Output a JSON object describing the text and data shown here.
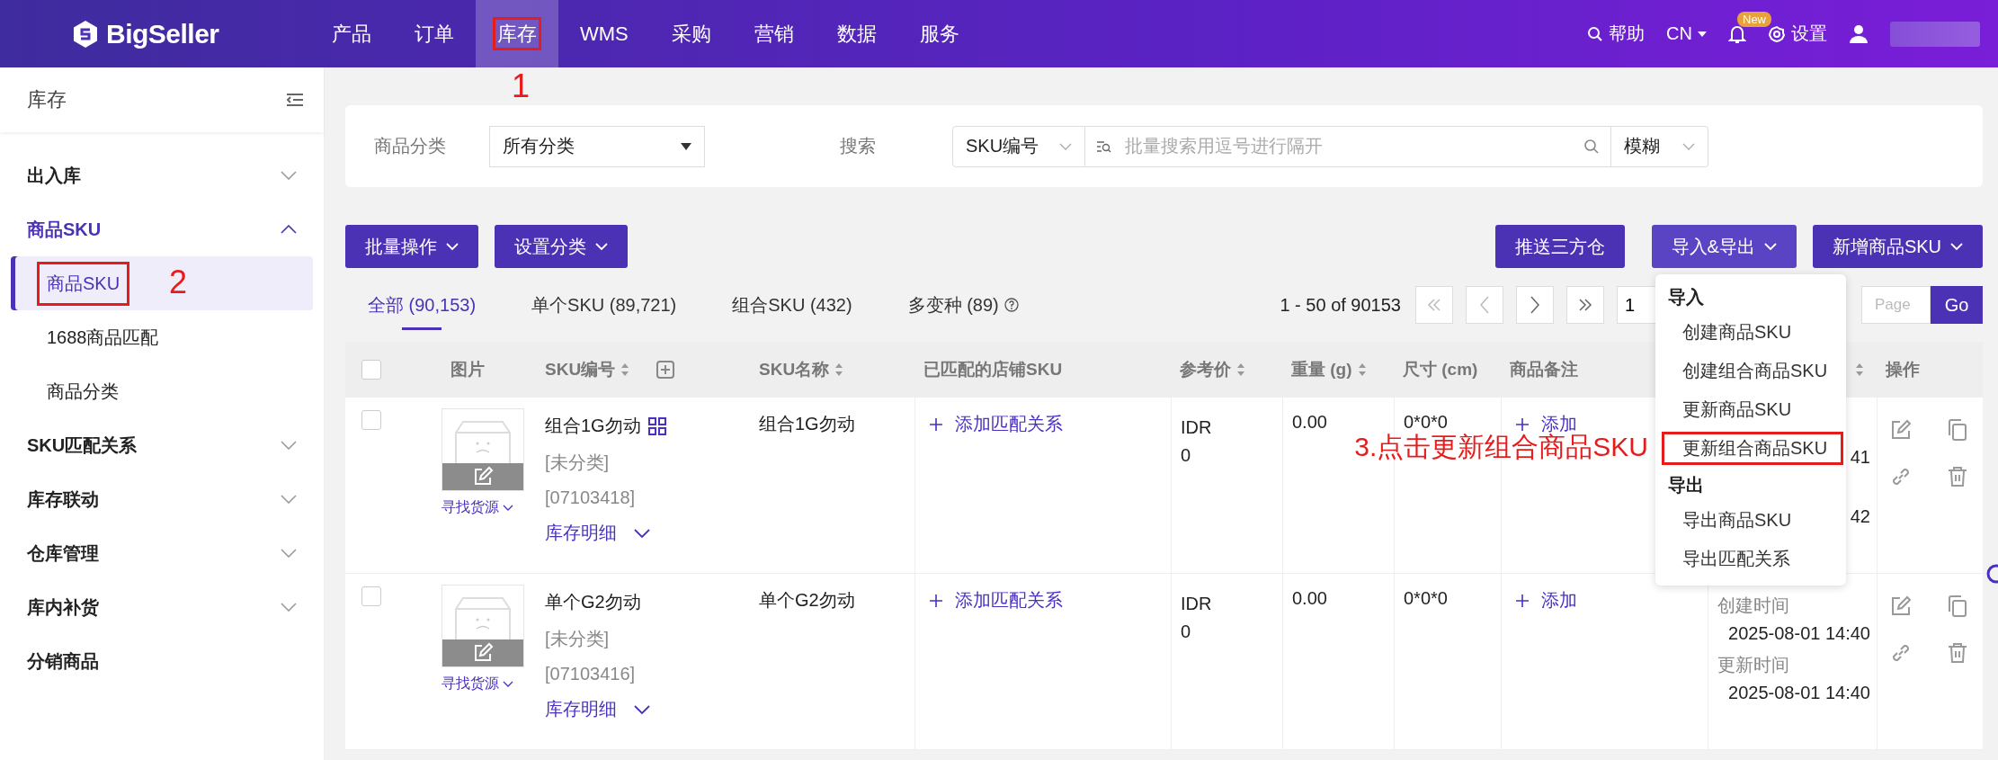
{
  "nav": {
    "logo": "BigSeller",
    "items": [
      {
        "label": "产品",
        "selected": false,
        "highlighted": false
      },
      {
        "label": "订单",
        "selected": false,
        "highlighted": false
      },
      {
        "label": "库存",
        "selected": true,
        "highlighted": true,
        "note": "1"
      },
      {
        "label": "WMS",
        "selected": false,
        "highlighted": false
      },
      {
        "label": "采购",
        "selected": false,
        "highlighted": false
      },
      {
        "label": "营销",
        "selected": false,
        "highlighted": false
      },
      {
        "label": "数据",
        "selected": false,
        "highlighted": false
      },
      {
        "label": "服务",
        "selected": false,
        "highlighted": false
      }
    ],
    "help": "帮助",
    "lang": "CN",
    "badge": "New",
    "settings": "设置"
  },
  "sidebar": {
    "title": "库存",
    "items": [
      {
        "label": "出入库",
        "kind": "group",
        "expanded": false
      },
      {
        "label": "商品SKU",
        "kind": "group",
        "expanded": true,
        "children": [
          {
            "label": "商品SKU",
            "selected": true,
            "highlighted": true,
            "note": "2"
          },
          {
            "label": "1688商品匹配",
            "selected": false,
            "highlighted": false
          },
          {
            "label": "商品分类",
            "selected": false,
            "highlighted": false
          }
        ]
      },
      {
        "label": "SKU匹配关系",
        "kind": "group",
        "expanded": false
      },
      {
        "label": "库存联动",
        "kind": "group",
        "expanded": false
      },
      {
        "label": "仓库管理",
        "kind": "group",
        "expanded": false
      },
      {
        "label": "库内补货",
        "kind": "group",
        "expanded": false
      },
      {
        "label": "分销商品",
        "kind": "link"
      }
    ]
  },
  "filters": {
    "category_label": "商品分类",
    "category_value": "所有分类",
    "search_label": "搜索",
    "search_field": "SKU编号",
    "search_placeholder": "批量搜索用逗号进行隔开",
    "match_mode": "模糊"
  },
  "toolbar": {
    "left": [
      "批量操作",
      "设置分类"
    ],
    "right": [
      "推送三方仓",
      "导入&导出",
      "新增商品SKU"
    ]
  },
  "tabs": [
    {
      "label": "全部 (90,153)",
      "selected": true,
      "help": false
    },
    {
      "label": "单个SKU (89,721)",
      "selected": false,
      "help": false
    },
    {
      "label": "组合SKU (432)",
      "selected": false,
      "help": false
    },
    {
      "label": "多变种 (89)",
      "selected": false,
      "help": true
    }
  ],
  "pagination": {
    "range": "1 - 50 of 90153",
    "page": "1",
    "page_placeholder": "Page",
    "go": "Go"
  },
  "table": {
    "columns": [
      {
        "kind": "checkbox",
        "checked": false
      },
      {
        "label": "图片"
      },
      {
        "label": "SKU编号",
        "sortable": true,
        "add": true
      },
      {
        "label": "SKU名称",
        "sortable": true
      },
      {
        "label": "已匹配的店铺SKU"
      },
      {
        "label": "参考价",
        "sortable": true
      },
      {
        "label": "重量 (g)",
        "sortable": true
      },
      {
        "label": "尺寸 (cm)"
      },
      {
        "label": "商品备注"
      },
      {
        "sortable": true
      },
      {
        "label": "操作"
      }
    ],
    "rows": [
      {
        "checked": false,
        "source": "寻找货源",
        "sku": "组合1G勿动",
        "combo": true,
        "category": "[未分类]",
        "code": "[07103418]",
        "stock": "库存明细",
        "name": "组合1G勿动",
        "match": "添加匹配关系",
        "price": [
          "IDR",
          "0"
        ],
        "weight": "0.00",
        "size": "0*0*0",
        "note": "添加",
        "times": [
          {
            "value": "41"
          },
          {
            "value": "42"
          }
        ]
      },
      {
        "checked": false,
        "source": "寻找货源",
        "sku": "单个G2勿动",
        "category": "[未分类]",
        "code": "[07103416]",
        "stock": "库存明细",
        "name": "单个G2勿动",
        "match": "添加匹配关系",
        "price": [
          "IDR",
          "0"
        ],
        "weight": "0.00",
        "size": "0*0*0",
        "note": "添加",
        "times": [
          {
            "label": "创建时间",
            "value": "2025-08-01 14:40"
          },
          {
            "label": "更新时间",
            "value": "2025-08-01 14:40"
          }
        ]
      }
    ]
  },
  "dropdown": {
    "sections": [
      {
        "title": "导入",
        "items": [
          {
            "label": "创建商品SKU",
            "highlighted": false
          },
          {
            "label": "创建组合商品SKU",
            "highlighted": false
          },
          {
            "label": "更新商品SKU",
            "highlighted": false
          },
          {
            "label": "更新组合商品SKU",
            "highlighted": true,
            "note": "3.点击更新组合商品SKU"
          }
        ]
      },
      {
        "title": "导出",
        "items": [
          {
            "label": "导出商品SKU",
            "highlighted": false
          },
          {
            "label": "导出匹配关系",
            "highlighted": false
          }
        ]
      }
    ]
  }
}
